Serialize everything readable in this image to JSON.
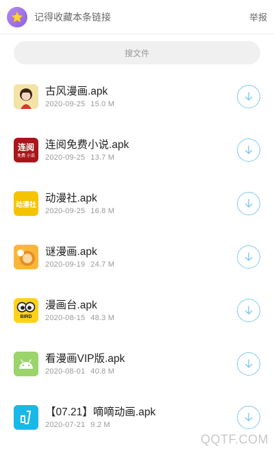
{
  "header": {
    "title": "记得收藏本条链接",
    "report_label": "举报",
    "badge_icon": "star-icon"
  },
  "search": {
    "placeholder": "搜文件"
  },
  "files": [
    {
      "name": "古风漫画.apk",
      "date": "2020-09-25",
      "size": "15.0 M",
      "icon": "gufeng-app-icon"
    },
    {
      "name": "连阅免费小说.apk",
      "date": "2020-09-25",
      "size": "13.7 M",
      "icon": "lianyue-app-icon"
    },
    {
      "name": "动漫社.apk",
      "date": "2020-09-25",
      "size": "16.8 M",
      "icon": "dongmanshe-app-icon"
    },
    {
      "name": "谜漫画.apk",
      "date": "2020-09-19",
      "size": "24.7 M",
      "icon": "mimanhua-app-icon"
    },
    {
      "name": "漫画台.apk",
      "date": "2020-08-15",
      "size": "48.3 M",
      "icon": "manhuatai-app-icon"
    },
    {
      "name": "看漫画VIP版.apk",
      "date": "2020-08-01",
      "size": "40.8 M",
      "icon": "android-app-icon"
    },
    {
      "name": "【07.21】嘀嘀动画.apk",
      "date": "2020-07-21",
      "size": "9.2 M",
      "icon": "didi-app-icon"
    }
  ],
  "icon_text": {
    "lianyue_top": "连阅",
    "lianyue_bottom": "免费 小说",
    "dongmanshe": "动漫社",
    "manhuatai": "BIRD"
  },
  "colors": {
    "accent": "#7fc8ef",
    "badge": "#9b6fe6",
    "star": "#ffd23c"
  },
  "watermark": "QQTF.COM"
}
